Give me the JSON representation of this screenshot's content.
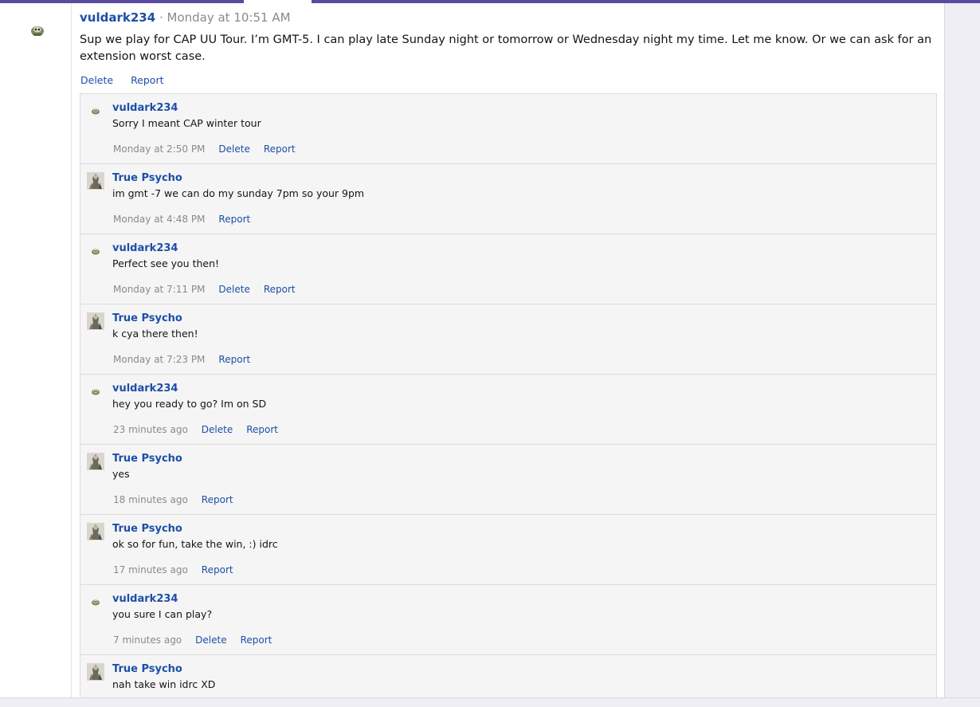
{
  "post": {
    "author": "vuldark234",
    "separator": "·",
    "time": "Monday at 10:51 AM",
    "body": "Sup we play for CAP UU Tour. I’m GMT-5. I can play late Sunday night or tomorrow or Wednesday night my time. Let me know. Or we can ask for an extension worst case.",
    "actions": {
      "delete": "Delete",
      "report": "Report"
    }
  },
  "comments": [
    {
      "author": "vuldark234",
      "avatar": "vuldark-avatar-icon",
      "text": "Sorry I meant CAP winter tour",
      "time": "Monday at 2:50 PM",
      "delete": "Delete",
      "report": "Report"
    },
    {
      "author": "True Psycho",
      "avatar": "true-psycho-avatar-icon",
      "text": "im gmt -7 we can do my sunday 7pm so your 9pm",
      "time": "Monday at 4:48 PM",
      "delete": "",
      "report": "Report"
    },
    {
      "author": "vuldark234",
      "avatar": "vuldark-avatar-icon",
      "text": "Perfect see you then!",
      "time": "Monday at 7:11 PM",
      "delete": "Delete",
      "report": "Report"
    },
    {
      "author": "True Psycho",
      "avatar": "true-psycho-avatar-icon",
      "text": "k cya there then!",
      "time": "Monday at 7:23 PM",
      "delete": "",
      "report": "Report"
    },
    {
      "author": "vuldark234",
      "avatar": "vuldark-avatar-icon",
      "text": "hey you ready to go? Im on SD",
      "time": "23 minutes ago",
      "delete": "Delete",
      "report": "Report"
    },
    {
      "author": "True Psycho",
      "avatar": "true-psycho-avatar-icon",
      "text": "yes",
      "time": "18 minutes ago",
      "delete": "",
      "report": "Report"
    },
    {
      "author": "True Psycho",
      "avatar": "true-psycho-avatar-icon",
      "text": "ok so for fun, take the win, :) idrc",
      "time": "17 minutes ago",
      "delete": "",
      "report": "Report"
    },
    {
      "author": "vuldark234",
      "avatar": "vuldark-avatar-icon",
      "text": "you sure I can play?",
      "time": "7 minutes ago",
      "delete": "Delete",
      "report": "Report"
    },
    {
      "author": "True Psycho",
      "avatar": "true-psycho-avatar-icon",
      "text": "nah take win idrc XD",
      "time": "",
      "delete": "",
      "report": ""
    }
  ]
}
